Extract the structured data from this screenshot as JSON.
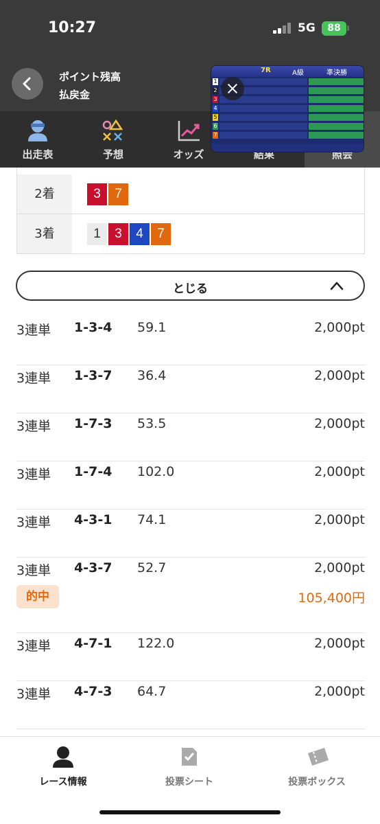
{
  "status": {
    "time": "10:27",
    "network": "5G",
    "battery": "88"
  },
  "header": {
    "points_label": "ポイント残高",
    "refund_label": "払戻金"
  },
  "video": {
    "race": "7R",
    "class": "A級",
    "kind": "準決勝"
  },
  "tabs": [
    {
      "label": "出走表",
      "icon": "racer-icon"
    },
    {
      "label": "予想",
      "icon": "prediction-icon"
    },
    {
      "label": "オッズ",
      "icon": "odds-chart-icon"
    },
    {
      "label": "結果",
      "icon": "result-icon"
    },
    {
      "label": "照会",
      "icon": "inquiry-icon"
    }
  ],
  "results": [
    {
      "place": "2着",
      "nums": [
        "3",
        "7"
      ]
    },
    {
      "place": "3着",
      "nums": [
        "1",
        "3",
        "4",
        "7"
      ]
    }
  ],
  "num_colors": {
    "1": "#ebebeb",
    "3": "#c8102e",
    "4": "#1f47c1",
    "7": "#e0680f"
  },
  "close_label": "とじる",
  "bets": [
    {
      "type": "3連単",
      "combo": "1-3-4",
      "odds": "59.1",
      "amount": "2,000pt"
    },
    {
      "type": "3連単",
      "combo": "1-3-7",
      "odds": "36.4",
      "amount": "2,000pt"
    },
    {
      "type": "3連単",
      "combo": "1-7-3",
      "odds": "53.5",
      "amount": "2,000pt"
    },
    {
      "type": "3連単",
      "combo": "1-7-4",
      "odds": "102.0",
      "amount": "2,000pt"
    },
    {
      "type": "3連単",
      "combo": "4-3-1",
      "odds": "74.1",
      "amount": "2,000pt"
    },
    {
      "type": "3連単",
      "combo": "4-3-7",
      "odds": "52.7",
      "amount": "2,000pt",
      "hit": "的中",
      "payout": "105,400円"
    },
    {
      "type": "3連単",
      "combo": "4-7-1",
      "odds": "122.0",
      "amount": "2,000pt"
    },
    {
      "type": "3連単",
      "combo": "4-7-3",
      "odds": "64.7",
      "amount": "2,000pt"
    }
  ],
  "bottom_nav": [
    {
      "label": "レース情報",
      "icon": "racer-icon",
      "active": true
    },
    {
      "label": "投票シート",
      "icon": "ballot-sheet-icon",
      "active": false
    },
    {
      "label": "投票ボックス",
      "icon": "ticket-box-icon",
      "active": false
    }
  ]
}
